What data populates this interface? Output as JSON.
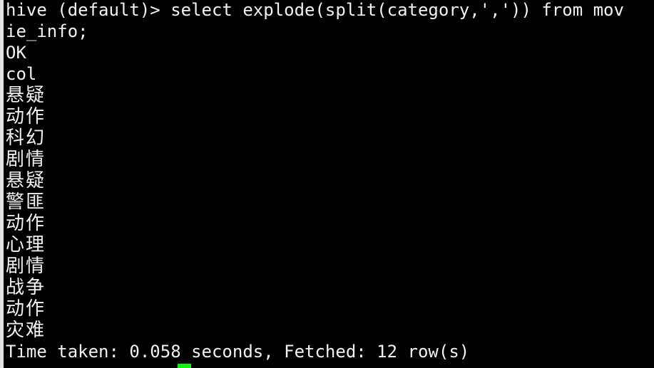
{
  "terminal": {
    "title": "hive-cli",
    "background_color": "#000000",
    "foreground_color": "#f2f2f2",
    "cursor_color": "#13f113",
    "edge_color": "#e2e2e2",
    "prompt": "hive (default)>",
    "lines": [
      {
        "id": "line-command-1",
        "type": "command",
        "text": "hive (default)> select explode(split(category,',')) from mov"
      },
      {
        "id": "line-command-2",
        "type": "command",
        "text": "ie_info;"
      },
      {
        "id": "line-status-ok",
        "type": "status",
        "text": "OK"
      },
      {
        "id": "line-column-header",
        "type": "header",
        "text": "col"
      },
      {
        "id": "line-result-1",
        "type": "result",
        "text": "悬疑"
      },
      {
        "id": "line-result-2",
        "type": "result",
        "text": "动作"
      },
      {
        "id": "line-result-3",
        "type": "result",
        "text": "科幻"
      },
      {
        "id": "line-result-4",
        "type": "result",
        "text": "剧情"
      },
      {
        "id": "line-result-5",
        "type": "result",
        "text": "悬疑"
      },
      {
        "id": "line-result-6",
        "type": "result",
        "text": "警匪"
      },
      {
        "id": "line-result-7",
        "type": "result",
        "text": "动作"
      },
      {
        "id": "line-result-8",
        "type": "result",
        "text": "心理"
      },
      {
        "id": "line-result-9",
        "type": "result",
        "text": "剧情"
      },
      {
        "id": "line-result-10",
        "type": "result",
        "text": "战争"
      },
      {
        "id": "line-result-11",
        "type": "result",
        "text": "动作"
      },
      {
        "id": "line-result-12",
        "type": "result",
        "text": "灾难"
      },
      {
        "id": "line-summary",
        "type": "summary",
        "text": "Time taken: 0.058 seconds, Fetched: 12 row(s)"
      }
    ],
    "summary": {
      "time_taken_seconds": "0.058",
      "fetched_rows": "12"
    }
  }
}
